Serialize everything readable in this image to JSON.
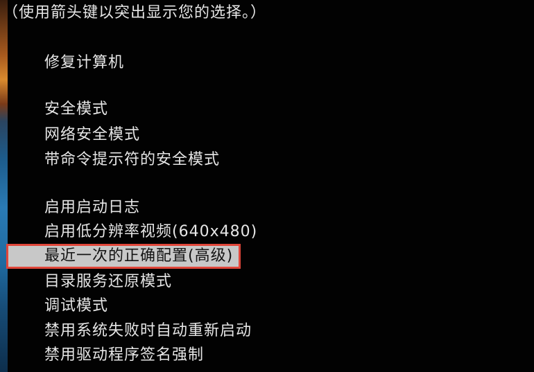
{
  "hint": "（使用箭头键以突出显示您的选择。）",
  "menu": [
    {
      "label": "修复计算机"
    },
    {
      "label": "安全模式"
    },
    {
      "label": "网络安全模式"
    },
    {
      "label": "带命令提示符的安全模式"
    },
    {
      "label": "启用启动日志"
    },
    {
      "label": "启用低分辨率视频(640x480)"
    },
    {
      "label": "最近一次的正确配置(高级)",
      "selected": true
    },
    {
      "label": "目录服务还原模式"
    },
    {
      "label": "调试模式"
    },
    {
      "label": "禁用系统失败时自动重新启动"
    },
    {
      "label": "禁用驱动程序签名强制"
    }
  ],
  "colors": {
    "background": "#020202",
    "text": "#e6e6e6",
    "highlight_bg": "#c8c8c8",
    "highlight_border": "#e0463a"
  }
}
